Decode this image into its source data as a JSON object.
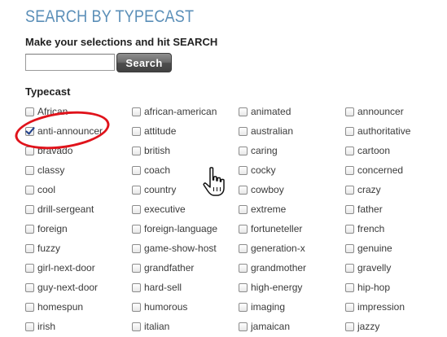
{
  "header": {
    "title": "SEARCH BY TYPECAST",
    "instructions": "Make your selections and hit SEARCH"
  },
  "search": {
    "value": "",
    "placeholder": "",
    "button_label": "Search"
  },
  "typecast": {
    "heading": "Typecast",
    "options": [
      {
        "label": "African",
        "checked": false
      },
      {
        "label": "african-american",
        "checked": false
      },
      {
        "label": "animated",
        "checked": false
      },
      {
        "label": "announcer",
        "checked": false
      },
      {
        "label": "anti-announcer",
        "checked": true
      },
      {
        "label": "attitude",
        "checked": false
      },
      {
        "label": "australian",
        "checked": false
      },
      {
        "label": "authoritative",
        "checked": false
      },
      {
        "label": "bravado",
        "checked": false
      },
      {
        "label": "british",
        "checked": false
      },
      {
        "label": "caring",
        "checked": false
      },
      {
        "label": "cartoon",
        "checked": false
      },
      {
        "label": "classy",
        "checked": false
      },
      {
        "label": "coach",
        "checked": false
      },
      {
        "label": "cocky",
        "checked": false
      },
      {
        "label": "concerned",
        "checked": false
      },
      {
        "label": "cool",
        "checked": false
      },
      {
        "label": "country",
        "checked": false
      },
      {
        "label": "cowboy",
        "checked": false
      },
      {
        "label": "crazy",
        "checked": false
      },
      {
        "label": "drill-sergeant",
        "checked": false
      },
      {
        "label": "executive",
        "checked": false
      },
      {
        "label": "extreme",
        "checked": false
      },
      {
        "label": "father",
        "checked": false
      },
      {
        "label": "foreign",
        "checked": false
      },
      {
        "label": "foreign-language",
        "checked": false
      },
      {
        "label": "fortuneteller",
        "checked": false
      },
      {
        "label": "french",
        "checked": false
      },
      {
        "label": "fuzzy",
        "checked": false
      },
      {
        "label": "game-show-host",
        "checked": false
      },
      {
        "label": "generation-x",
        "checked": false
      },
      {
        "label": "genuine",
        "checked": false
      },
      {
        "label": "girl-next-door",
        "checked": false
      },
      {
        "label": "grandfather",
        "checked": false
      },
      {
        "label": "grandmother",
        "checked": false
      },
      {
        "label": "gravelly",
        "checked": false
      },
      {
        "label": "guy-next-door",
        "checked": false
      },
      {
        "label": "hard-sell",
        "checked": false
      },
      {
        "label": "high-energy",
        "checked": false
      },
      {
        "label": "hip-hop",
        "checked": false
      },
      {
        "label": "homespun",
        "checked": false
      },
      {
        "label": "humorous",
        "checked": false
      },
      {
        "label": "imaging",
        "checked": false
      },
      {
        "label": "impression",
        "checked": false
      },
      {
        "label": "irish",
        "checked": false
      },
      {
        "label": "italian",
        "checked": false
      },
      {
        "label": "jamaican",
        "checked": false
      },
      {
        "label": "jazzy",
        "checked": false
      }
    ]
  },
  "annotation": {
    "circled_option": "anti-announcer",
    "color": "#e0131b"
  },
  "cursor": {
    "icon": "hand-pointer-icon"
  },
  "colors": {
    "title": "#5b8fb8",
    "button": "#555555",
    "checkmark": "#1f3f8a"
  }
}
